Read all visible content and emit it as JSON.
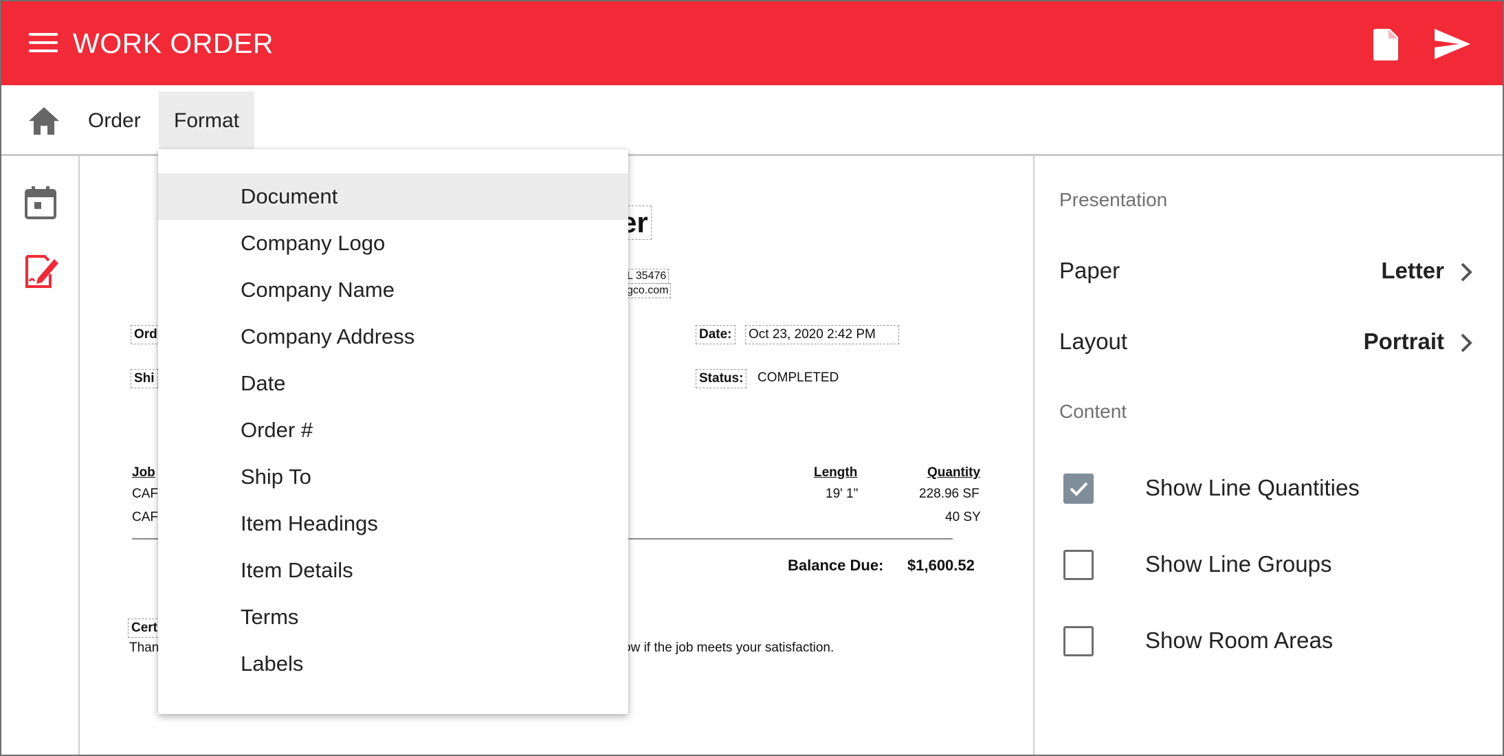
{
  "app": {
    "title": "WORK ORDER"
  },
  "header_icons": {
    "menu": "menu-icon",
    "pdf": "document-icon",
    "send": "send-icon"
  },
  "tabs": {
    "home_icon": "home-icon",
    "order": "Order",
    "format": "Format"
  },
  "rail": {
    "items": [
      "calendar-icon",
      "signature-edit-icon"
    ],
    "active_color": "#f22a37"
  },
  "document": {
    "title_partial": "er",
    "addr_line1_partial": "L 35476",
    "addr_line2_partial": "gco.com",
    "order_label_partial": "Ord",
    "ship_label_partial": "Shi",
    "date_label": "Date:",
    "date_value": "Oct 23, 2020 2:42 PM",
    "status_label": "Status:",
    "status_value": "COMPLETED",
    "job_header_partial": "Job",
    "row1_partial": "CAF",
    "row2_partial": "CAF",
    "length_header": "Length",
    "quantity_header": "Quantity",
    "row1_length": "19' 1\"",
    "row1_quantity": "228.96 SF",
    "row2_quantity": "40 SY",
    "balance_label": "Balance Due:",
    "balance_value": "$1,600.52",
    "cert_label_partial": "Cert",
    "thanks_partial": "Than",
    "terms_tail": "ow if the job meets your satisfaction."
  },
  "format_menu": {
    "items": [
      "Document",
      "Company Logo",
      "Company Name",
      "Company Address",
      "Date",
      "Order #",
      "Ship To",
      "Item Headings",
      "Item Details",
      "Terms",
      "Labels"
    ],
    "selected": "Document"
  },
  "panel": {
    "presentation_title": "Presentation",
    "paper_label": "Paper",
    "paper_value": "Letter",
    "layout_label": "Layout",
    "layout_value": "Portrait",
    "content_title": "Content",
    "options": [
      {
        "label": "Show Line Quantities",
        "checked": true
      },
      {
        "label": "Show Line Groups",
        "checked": false
      },
      {
        "label": "Show Room Areas",
        "checked": false
      }
    ]
  },
  "colors": {
    "brand_red": "#f22a37",
    "checkbox_checked": "#7f8e99",
    "menu_highlight": "#ececec"
  }
}
